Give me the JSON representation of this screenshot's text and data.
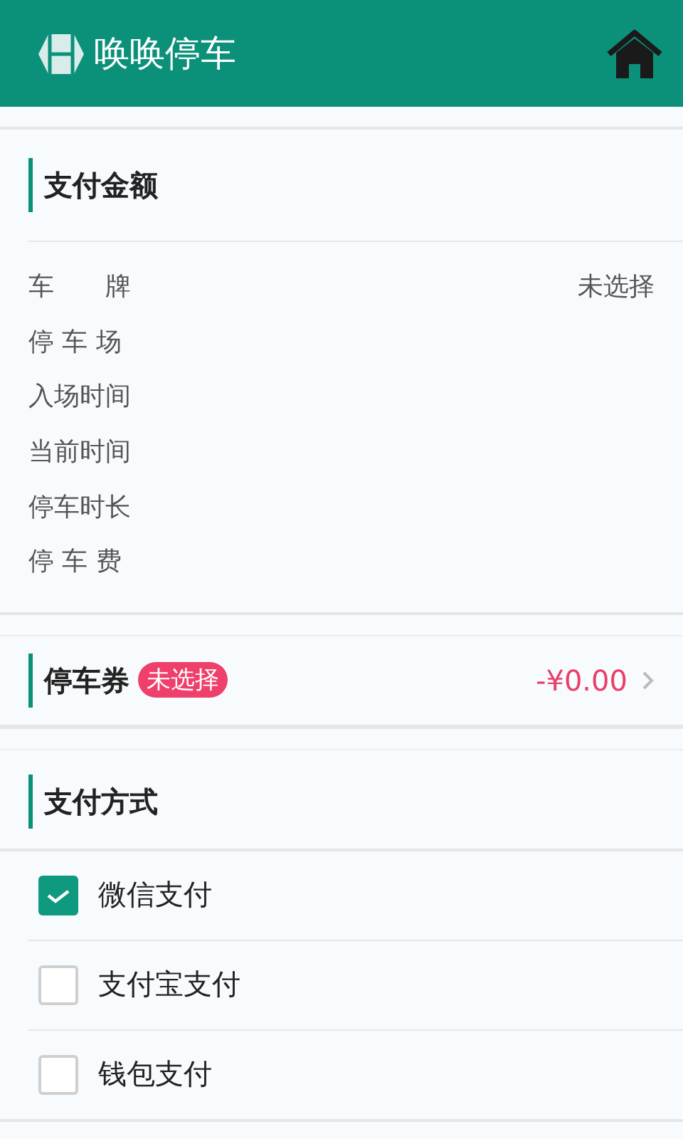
{
  "header": {
    "title": "唤唤停车"
  },
  "amount_section": {
    "title": "支付金额",
    "rows": [
      {
        "label": "车　　牌",
        "value": "未选择"
      },
      {
        "label": "停 车 场"
      },
      {
        "label": "入场时间"
      },
      {
        "label": "当前时间"
      },
      {
        "label": "停车时长"
      },
      {
        "label": "停 车 费"
      }
    ]
  },
  "coupon": {
    "title": "停车券",
    "badge": "未选择",
    "amount": "-¥0.00"
  },
  "payment_section": {
    "title": "支付方式",
    "options": [
      {
        "label": "微信支付",
        "checked": true
      },
      {
        "label": "支付宝支付",
        "checked": false
      },
      {
        "label": "钱包支付",
        "checked": false
      }
    ]
  }
}
